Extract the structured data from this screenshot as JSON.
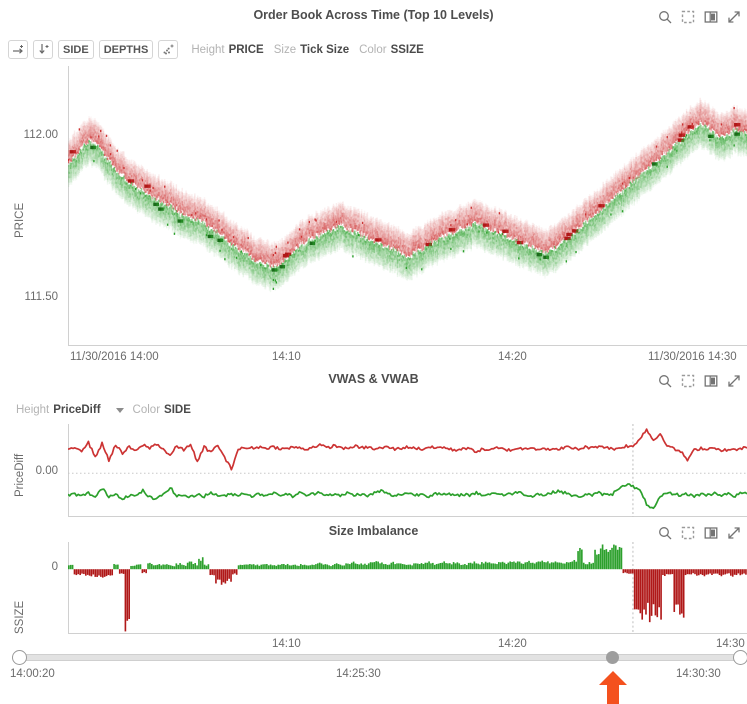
{
  "panels": {
    "orderbook": {
      "title": "Order Book Across Time (Top 10 Levels)",
      "ylabel": "PRICE",
      "yticks": [
        "112.00",
        "111.50"
      ],
      "xticks": [
        "11/30/2016 14:00",
        "14:10",
        "14:20",
        "11/30/2016 14:30"
      ],
      "toolbar": {
        "btn_right_arrow": "→",
        "btn_down_arrow": "↓",
        "btn_side": "SIDE",
        "btn_depths": "DEPTHS",
        "btn_points": "dots",
        "height_label": "Height",
        "height_value": "PRICE",
        "size_label": "Size",
        "size_value": "Tick Size",
        "color_label": "Color",
        "color_value": "SSIZE"
      },
      "icons": [
        "search-icon",
        "select-region-icon",
        "panel-toggle-icon",
        "expand-icon"
      ]
    },
    "vwas": {
      "title": "VWAS & VWAB",
      "ylabel": "PriceDiff",
      "yticks": [
        "0.00"
      ],
      "toolbar": {
        "height_label": "Height",
        "height_value": "PriceDiff",
        "color_label": "Color",
        "color_value": "SIDE"
      },
      "icons": [
        "search-icon",
        "select-region-icon",
        "panel-toggle-icon",
        "expand-icon"
      ]
    },
    "imbalance": {
      "title": "Size Imbalance",
      "ylabel": "SSIZE",
      "yticks": [
        "0"
      ],
      "xticks": [
        "14:10",
        "14:20",
        "14:30"
      ],
      "icons": [
        "search-icon",
        "select-region-icon",
        "panel-toggle-icon",
        "expand-icon"
      ]
    }
  },
  "slider": {
    "left_label": "14:00:20",
    "mid_label": "14:25:30",
    "right_label": "14:30:30",
    "knob_position_pct": 82.5,
    "annotation": "red-up-arrow"
  },
  "colors": {
    "ask_red": "#cc3333",
    "bid_green": "#2ca02c",
    "annotation_red": "#f4511e",
    "axis_gray": "#6b6b6b",
    "muted_gray": "#b3b3b3",
    "track_gray": "#e2e2e2"
  },
  "chart_data": [
    {
      "type": "heatmap",
      "name": "order-book-depth",
      "title": "Order Book Across Time (Top 10 Levels)",
      "xlabel": "",
      "ylabel": "PRICE",
      "ylim": [
        111.3,
        112.25
      ],
      "ytick_values": [
        112.0,
        111.5
      ],
      "xlim": [
        "11/30/2016 14:00",
        "11/30/2016 14:30"
      ],
      "xtick_values": [
        "11/30/2016 14:00",
        "14:10",
        "14:20",
        "11/30/2016 14:30"
      ],
      "levels": 10,
      "series": [
        {
          "name": "ask",
          "color": "#cc3333"
        },
        {
          "name": "bid",
          "color": "#2ca02c"
        }
      ],
      "mid_price": [
        111.92,
        111.95,
        111.98,
        112.0,
        111.99,
        111.96,
        111.93,
        111.9,
        111.88,
        111.86,
        111.84,
        111.83,
        111.81,
        111.8,
        111.79,
        111.78,
        111.76,
        111.75,
        111.74,
        111.73,
        111.72,
        111.7,
        111.69,
        111.67,
        111.65,
        111.63,
        111.62,
        111.6,
        111.59,
        111.58,
        111.57,
        111.58,
        111.6,
        111.62,
        111.64,
        111.66,
        111.67,
        111.68,
        111.69,
        111.7,
        111.71,
        111.7,
        111.69,
        111.68,
        111.67,
        111.66,
        111.65,
        111.64,
        111.63,
        111.62,
        111.61,
        111.62,
        111.63,
        111.65,
        111.66,
        111.67,
        111.68,
        111.69,
        111.7,
        111.71,
        111.72,
        111.71,
        111.7,
        111.69,
        111.68,
        111.67,
        111.66,
        111.65,
        111.64,
        111.63,
        111.62,
        111.63,
        111.64,
        111.66,
        111.68,
        111.7,
        111.72,
        111.74,
        111.76,
        111.78,
        111.8,
        111.82,
        111.84,
        111.86,
        111.88,
        111.9,
        111.92,
        111.94,
        111.96,
        111.98,
        112.0,
        112.02,
        112.04,
        112.06,
        112.05,
        112.03,
        112.01,
        112.02,
        112.04,
        112.03
      ]
    },
    {
      "type": "line",
      "name": "vwas-vwab",
      "title": "VWAS & VWAB",
      "xlabel": "",
      "ylabel": "PriceDiff",
      "ylim": [
        -0.04,
        0.045
      ],
      "ytick_values": [
        0.0
      ],
      "grid": true,
      "legend": "none",
      "series": [
        {
          "name": "VWAS",
          "color": "#cc3333",
          "side": "ask",
          "values": [
            0.022,
            0.024,
            0.021,
            0.028,
            0.015,
            0.027,
            0.012,
            0.026,
            0.018,
            0.024,
            0.02,
            0.026,
            0.023,
            0.027,
            0.022,
            0.016,
            0.025,
            0.021,
            0.027,
            0.01,
            0.024,
            0.019,
            0.026,
            0.014,
            0.004,
            0.022,
            0.023,
            0.023,
            0.024,
            0.023,
            0.024,
            0.023,
            0.022,
            0.024,
            0.023,
            0.022,
            0.024,
            0.026,
            0.023,
            0.025,
            0.024,
            0.022,
            0.025,
            0.023,
            0.024,
            0.022,
            0.023,
            0.024,
            0.022,
            0.023,
            0.024,
            0.023,
            0.022,
            0.024,
            0.023,
            0.024,
            0.022,
            0.021,
            0.023,
            0.022,
            0.02,
            0.022,
            0.021,
            0.023,
            0.022,
            0.021,
            0.023,
            0.022,
            0.024,
            0.022,
            0.023,
            0.021,
            0.022,
            0.024,
            0.023,
            0.022,
            0.024,
            0.023,
            0.025,
            0.024,
            0.022,
            0.023,
            0.025,
            0.024,
            0.032,
            0.04,
            0.03,
            0.036,
            0.026,
            0.022,
            0.02,
            0.012,
            0.021,
            0.023,
            0.022,
            0.024,
            0.02,
            0.022,
            0.021,
            0.023
          ]
        },
        {
          "name": "VWAB",
          "color": "#2ca02c",
          "side": "bid",
          "values": [
            -0.02,
            -0.019,
            -0.021,
            -0.018,
            -0.022,
            -0.014,
            -0.021,
            -0.019,
            -0.023,
            -0.02,
            -0.021,
            -0.016,
            -0.022,
            -0.024,
            -0.019,
            -0.013,
            -0.021,
            -0.02,
            -0.022,
            -0.019,
            -0.021,
            -0.018,
            -0.02,
            -0.021,
            -0.019,
            -0.02,
            -0.018,
            -0.021,
            -0.019,
            -0.02,
            -0.018,
            -0.02,
            -0.019,
            -0.021,
            -0.018,
            -0.02,
            -0.019,
            -0.017,
            -0.02,
            -0.019,
            -0.021,
            -0.018,
            -0.02,
            -0.019,
            -0.021,
            -0.018,
            -0.016,
            -0.019,
            -0.021,
            -0.019,
            -0.018,
            -0.02,
            -0.019,
            -0.021,
            -0.018,
            -0.02,
            -0.019,
            -0.021,
            -0.019,
            -0.02,
            -0.018,
            -0.02,
            -0.019,
            -0.018,
            -0.02,
            -0.019,
            -0.017,
            -0.019,
            -0.021,
            -0.019,
            -0.02,
            -0.018,
            -0.016,
            -0.018,
            -0.02,
            -0.022,
            -0.019,
            -0.02,
            -0.018,
            -0.02,
            -0.019,
            -0.013,
            -0.01,
            -0.012,
            -0.016,
            -0.028,
            -0.033,
            -0.022,
            -0.018,
            -0.019,
            -0.02,
            -0.019,
            -0.021,
            -0.019,
            -0.02,
            -0.018,
            -0.02,
            -0.019,
            -0.021,
            -0.018
          ]
        }
      ]
    },
    {
      "type": "bar",
      "name": "size-imbalance",
      "title": "Size Imbalance",
      "xlabel": "",
      "ylabel": "SSIZE",
      "ylim": [
        -100,
        42
      ],
      "ytick_values": [
        0
      ],
      "xtick_values": [
        "14:10",
        "14:20",
        "14:30"
      ],
      "series": [
        {
          "name": "bid-imbalance",
          "color": "#2ca02c"
        },
        {
          "name": "ask-imbalance",
          "color": "#b01818"
        }
      ],
      "values": [
        6,
        -8,
        -9,
        -10,
        -11,
        -12,
        -13,
        -9,
        8,
        -7,
        -96,
        5,
        7,
        -6,
        9,
        6,
        8,
        7,
        6,
        9,
        7,
        10,
        8,
        16,
        7,
        -9,
        -22,
        -24,
        -18,
        -8,
        6,
        7,
        8,
        6,
        7,
        8,
        6,
        7,
        8,
        6,
        7,
        8,
        6,
        7,
        9,
        7,
        6,
        8,
        7,
        9,
        10,
        8,
        7,
        9,
        11,
        9,
        8,
        10,
        9,
        8,
        7,
        9,
        8,
        10,
        9,
        8,
        10,
        9,
        11,
        9,
        8,
        10,
        9,
        11,
        10,
        9,
        11,
        10,
        12,
        10,
        9,
        11,
        10,
        12,
        11,
        9,
        12,
        10,
        11,
        12,
        28,
        10,
        11,
        30,
        32,
        31,
        33,
        30,
        -6,
        -7,
        -62,
        -68,
        -70,
        -72,
        -74,
        -9,
        -8,
        -66,
        -70,
        -9,
        -8,
        -10,
        -9,
        -8,
        -7,
        -9,
        -8,
        -10,
        -9,
        -8
      ]
    }
  ]
}
